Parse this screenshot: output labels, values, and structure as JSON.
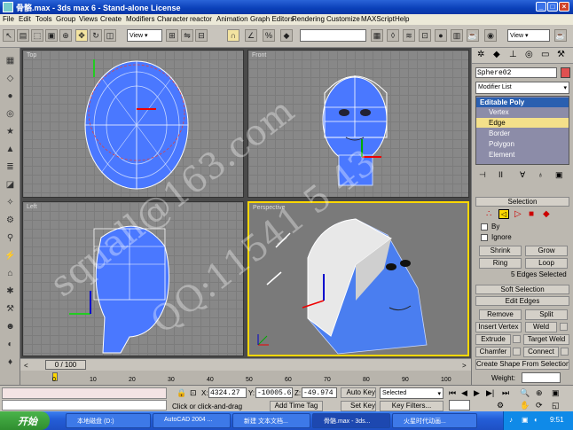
{
  "title": "骨骼.max - 3ds max 6 - Stand-alone License",
  "menu": [
    "File",
    "Edit",
    "Tools",
    "Group",
    "Views",
    "Create",
    "Modifiers",
    "Character",
    "reactor",
    "Animation",
    "Graph Editors",
    "Rendering",
    "Customize",
    "MAXScript",
    "Help"
  ],
  "toolbar": {
    "view_dropdown": "View",
    "view_dropdown2": "View"
  },
  "viewports": {
    "top": "Top",
    "front": "Front",
    "left": "Left",
    "perspective": "Perspective"
  },
  "watermark": {
    "line1": "squall@163.com",
    "line2": "QQ:11541 5 43"
  },
  "command_panel": {
    "object_name": "Sphere02",
    "object_color": "#e05050",
    "modifier_list": "Modifier List",
    "stack": [
      "Editable Poly",
      "Vertex",
      "Edge",
      "Border",
      "Polygon",
      "Element"
    ],
    "selection_header": "Selection",
    "by_label": "By",
    "ignore_label": "Ignore",
    "shrink": "Shrink",
    "grow": "Grow",
    "ring": "Ring",
    "loop": "Loop",
    "sel_status": "5 Edges Selected",
    "soft_selection": "Soft Selection",
    "edit_edges": "Edit Edges",
    "remove": "Remove",
    "split": "Split",
    "insert_vertex": "Insert Vertex",
    "weld": "Weld",
    "extrude": "Extrude",
    "target_weld": "Target Weld",
    "chamfer": "Chamfer",
    "connect": "Connect",
    "create_shape": "Create Shape From Selection",
    "weight_label": "Weight:"
  },
  "timeline": {
    "frame": "0 / 100",
    "ticks": [
      "0",
      "10",
      "20",
      "30",
      "40",
      "50",
      "60",
      "70",
      "80",
      "90",
      "100"
    ]
  },
  "status": {
    "x_label": "X:",
    "x_value": "4324.27",
    "y_label": "Y:",
    "y_value": "-10005.6",
    "z_label": "Z:",
    "z_value": "-49.974",
    "auto_key": "Auto Key",
    "selected": "Selected",
    "set_key": "Set Key",
    "key_filters": "Key Filters...",
    "prompt": "Click or click-and-drag",
    "add_time_tag": "Add Time Tag"
  },
  "taskbar": {
    "start": "开始",
    "items": [
      "本地磁盘 (D:)",
      "AutoCAD 2004 ...",
      "新建 文本文档...",
      "骨骼.max - 3ds...",
      "火星时代动画..."
    ],
    "clock": "9:51"
  },
  "colors": {
    "active_viewport": "#ffd800",
    "mesh_blue": "#4a78ff",
    "selection_yellow": "#ffd800"
  }
}
